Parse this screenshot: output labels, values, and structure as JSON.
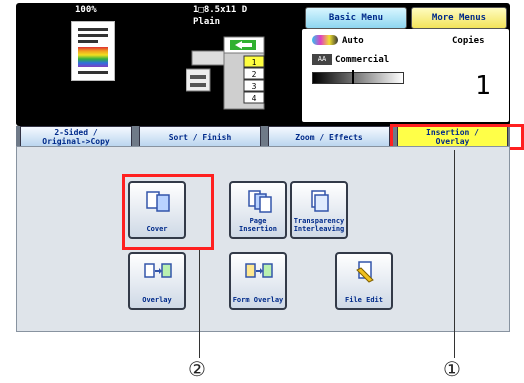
{
  "status": {
    "zoom": "100%",
    "paper_size": "1□8.5x11 D",
    "paper_type": "Plain",
    "density_mode": "Auto",
    "original_type": "Commercial",
    "copies_label": "Copies",
    "copies_count": "1"
  },
  "header": {
    "basic_menu": "Basic Menu",
    "more_menus": "More Menus"
  },
  "tabs": [
    {
      "label": "2-Sided /\nOriginal->Copy",
      "active": false
    },
    {
      "label": "Sort / Finish",
      "active": false
    },
    {
      "label": "Zoom / Effects",
      "active": false
    },
    {
      "label": "Insertion /\nOverlay",
      "active": true
    }
  ],
  "functions": [
    {
      "label": "Cover",
      "icon": "cover-icon"
    },
    {
      "label": "Page\nInsertion",
      "icon": "page-insertion-icon"
    },
    {
      "label": "Transparency\nInterleaving",
      "icon": "transparency-icon"
    },
    {
      "label": "Overlay",
      "icon": "overlay-icon"
    },
    {
      "label": "Form Overlay",
      "icon": "form-overlay-icon"
    },
    {
      "label": "File Edit",
      "icon": "file-edit-icon"
    }
  ],
  "callouts": {
    "one": "①",
    "two": "②"
  },
  "colors": {
    "highlight": "#ff2020",
    "active_tab": "#ffff48",
    "accent_text": "#002a8a"
  },
  "machine_trays": [
    "1",
    "2",
    "3",
    "4"
  ]
}
